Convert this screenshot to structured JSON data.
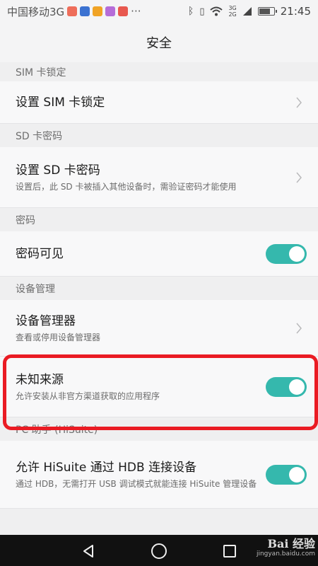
{
  "statusbar": {
    "carrier": "中国移动3G",
    "net_top": "3G",
    "net_bottom": "2G",
    "time": "21:45",
    "battery_level": 0.8,
    "app_colors": [
      "#ee6d5a",
      "#3b72d1",
      "#f0a325",
      "#b56cd8",
      "#e8584f"
    ]
  },
  "appbar": {
    "title": "安全"
  },
  "sections": {
    "sim": {
      "header": "SIM 卡锁定",
      "row_title": "设置 SIM 卡锁定"
    },
    "sd": {
      "header": "SD 卡密码",
      "row_title": "设置 SD 卡密码",
      "row_subtitle": "设置后，此 SD 卡被插入其他设备时，需验证密码才能使用"
    },
    "password": {
      "header": "密码",
      "row_title": "密码可见",
      "toggle_on": true
    },
    "device": {
      "header": "设备管理",
      "admin_title": "设备管理器",
      "admin_subtitle": "查看或停用设备管理器",
      "unknown_title": "未知来源",
      "unknown_subtitle": "允许安装从非官方渠道获取的应用程序",
      "unknown_toggle_on": true
    },
    "hisuite": {
      "header": "PC 助手 (HiSuite)",
      "row_title": "允许 HiSuite 通过 HDB 连接设备",
      "row_subtitle": "通过 HDB，无需打开 USB 调试模式就能连接 HiSuite 管理设备",
      "toggle_on": true
    }
  },
  "colors": {
    "toggle_on": "#35b8ad",
    "highlight": "#ea1b23"
  },
  "watermark": {
    "brand": "Bai 经验",
    "url": "jingyan.baidu.com"
  }
}
